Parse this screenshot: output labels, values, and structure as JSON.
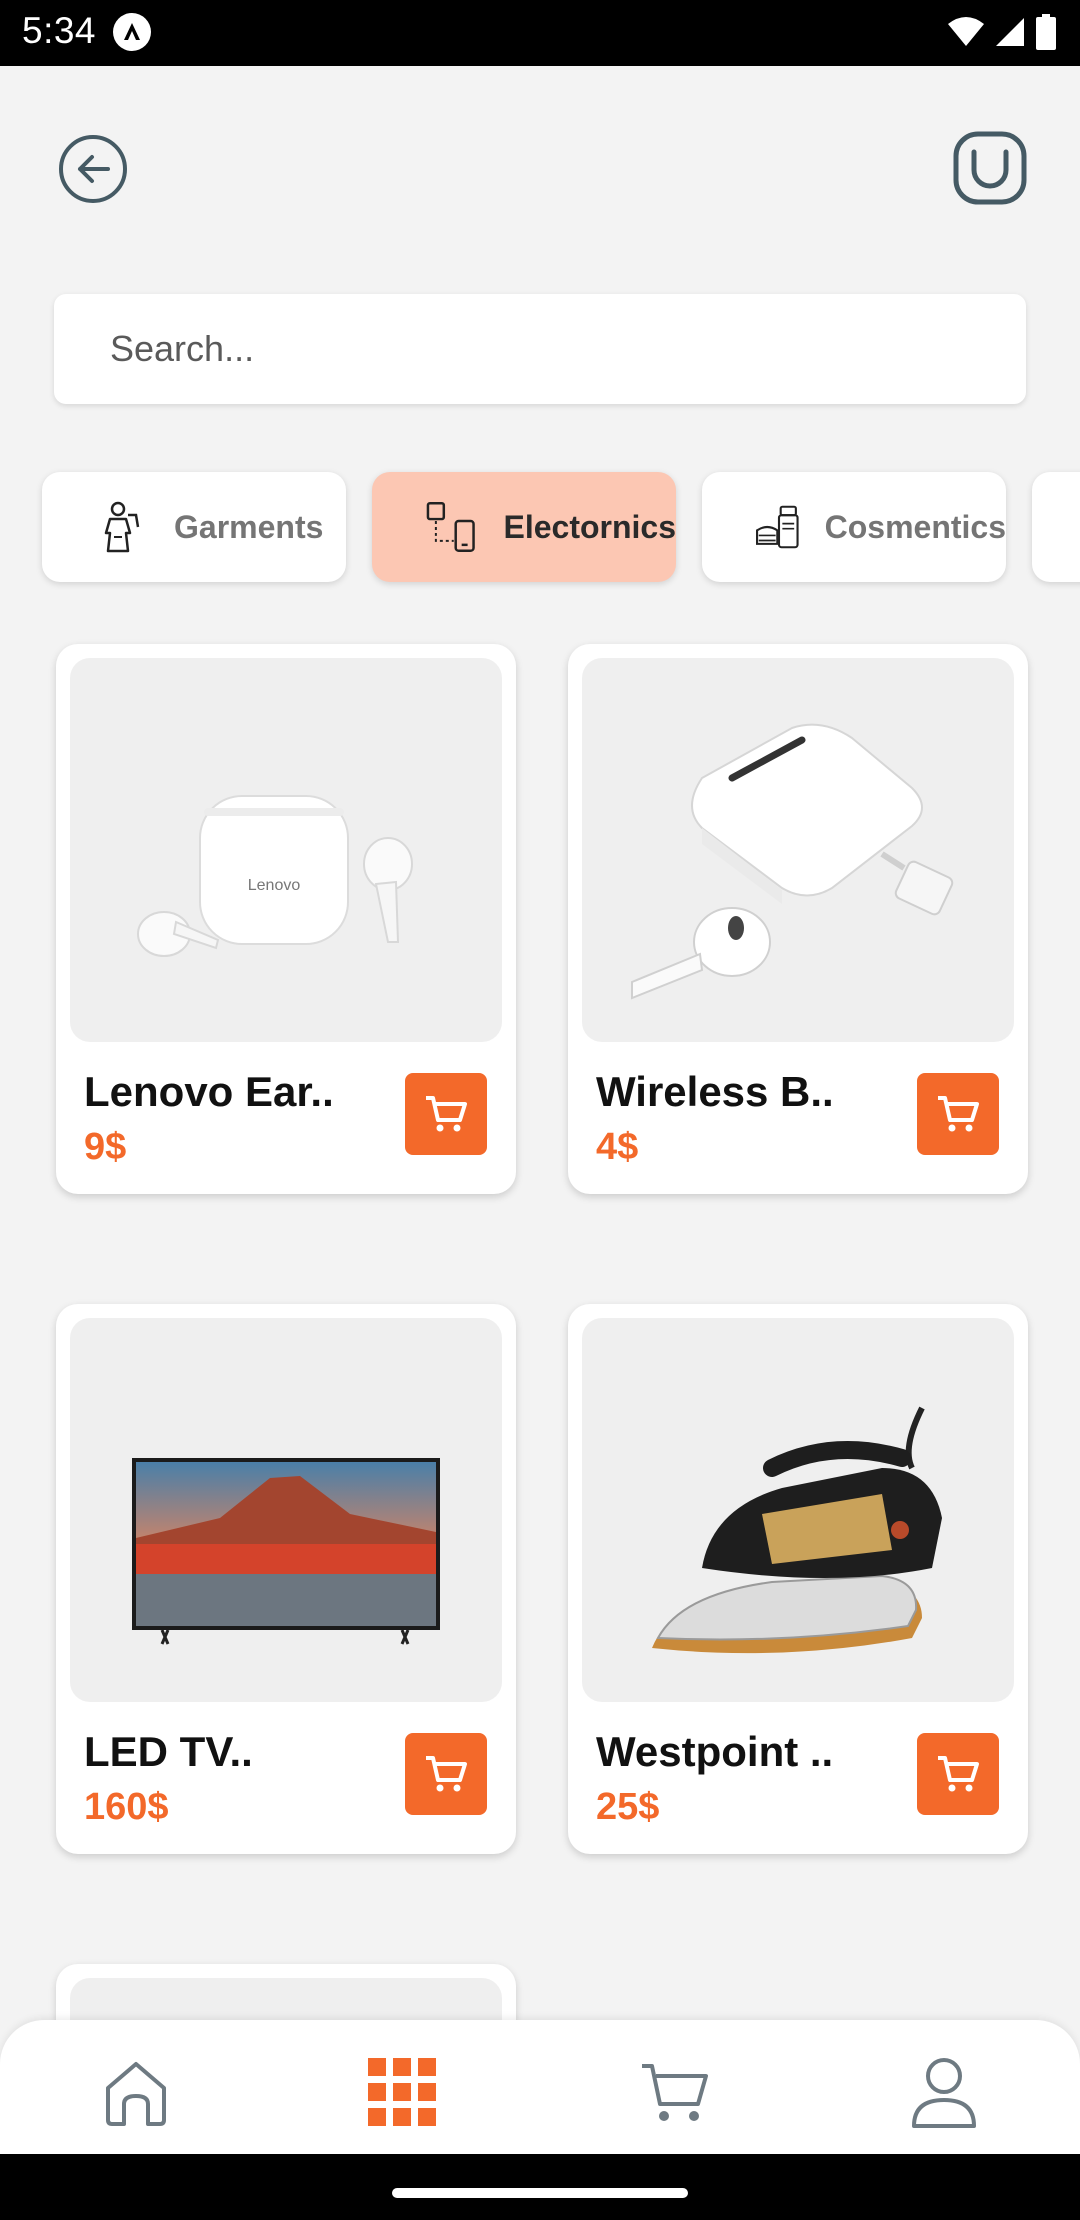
{
  "status_bar": {
    "time": "5:34"
  },
  "search": {
    "placeholder": "Search..."
  },
  "categories": [
    {
      "label": "Garments",
      "icon": "garments-icon",
      "active": false
    },
    {
      "label": "Electornics",
      "icon": "electronics-icon",
      "active": true
    },
    {
      "label": "Cosmentics",
      "icon": "cosmetics-icon",
      "active": false
    }
  ],
  "products": [
    {
      "name": "Lenovo Ear..",
      "price": "9$",
      "image_brand_text": "Lenovo"
    },
    {
      "name": "Wireless B..",
      "price": "4$"
    },
    {
      "name": "LED TV..",
      "price": "160$"
    },
    {
      "name": "Westpoint ..",
      "price": "25$"
    }
  ],
  "bottom_nav": {
    "items": [
      {
        "name": "home",
        "icon": "home-icon",
        "active": false
      },
      {
        "name": "categories",
        "icon": "grid-icon",
        "active": true
      },
      {
        "name": "cart",
        "icon": "cart-icon",
        "active": false
      },
      {
        "name": "profile",
        "icon": "user-icon",
        "active": false
      }
    ]
  },
  "colors": {
    "accent": "#f3692a",
    "active_category_bg": "#fcc7b3",
    "background": "#f3f3f3"
  }
}
